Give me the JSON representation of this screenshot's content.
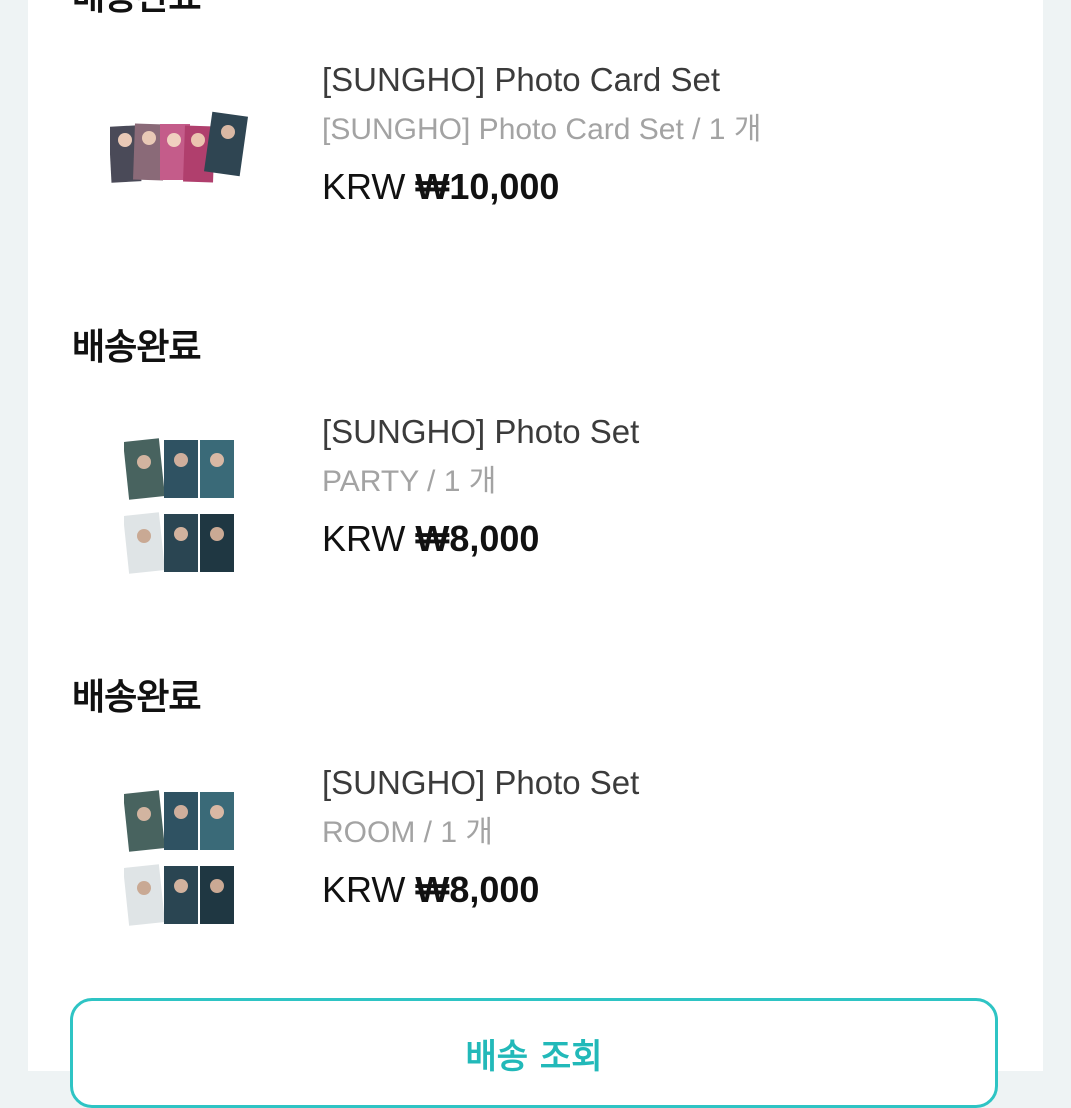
{
  "orders": [
    {
      "status": "배송완료",
      "product_name": "[SUNGHO] Photo Card Set",
      "option": "[SUNGHO] Photo Card Set / 1 개",
      "currency": "KRW",
      "price": "₩10,000",
      "thumbnail": "photo-card-set-thumbnail"
    },
    {
      "status": "배송완료",
      "product_name": "[SUNGHO] Photo Set",
      "option": "PARTY / 1 개",
      "currency": "KRW",
      "price": "₩8,000",
      "thumbnail": "photo-set-thumbnail"
    },
    {
      "status": "배송완료",
      "product_name": "[SUNGHO] Photo Set",
      "option": "ROOM / 1 개",
      "currency": "KRW",
      "price": "₩8,000",
      "thumbnail": "photo-set-thumbnail"
    }
  ],
  "actions": {
    "track_delivery_label": "배송 조회"
  },
  "colors": {
    "accent": "#2ec4c4",
    "background": "#eef3f4"
  }
}
